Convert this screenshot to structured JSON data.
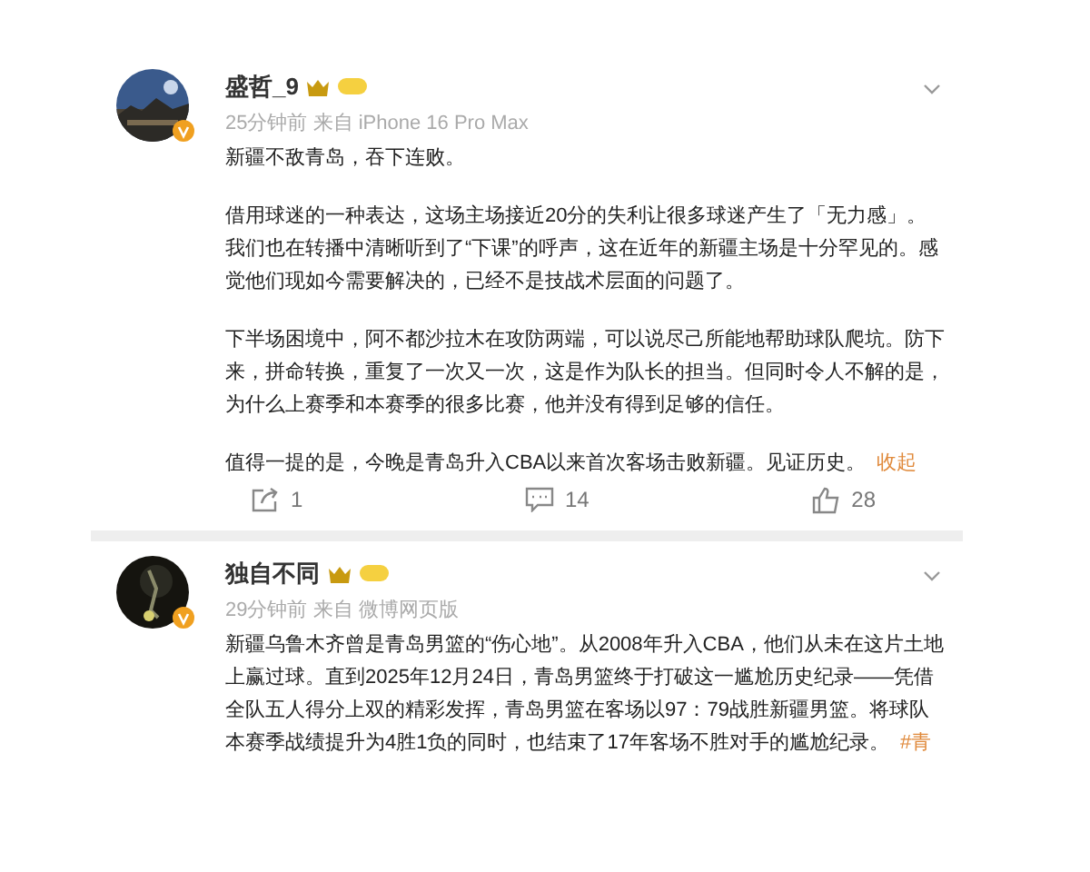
{
  "posts": [
    {
      "author": "盛哲_9",
      "meta": "25分钟前 来自 iPhone 16 Pro Max",
      "paragraphs": [
        "新疆不敌青岛，吞下连败。",
        "借用球迷的一种表达，这场主场接近20分的失利让很多球迷产生了「无力感」。我们也在转播中清晰听到了“下课”的呼声，这在近年的新疆主场是十分罕见的。感觉他们现如今需要解决的，已经不是技战术层面的问题了。",
        "下半场困境中，阿不都沙拉木在攻防两端，可以说尽己所能地帮助球队爬坑。防下来，拼命转换，重复了一次又一次，这是作为队长的担当。但同时令人不解的是，为什么上赛季和本赛季的很多比赛，他并没有得到足够的信任。",
        "值得一提的是，今晚是青岛升入CBA以来首次客场击败新疆。见证历史。"
      ],
      "link": "收起",
      "actions": [
        {
          "kind": "share",
          "count": "1"
        },
        {
          "kind": "comment",
          "count": "14"
        },
        {
          "kind": "like",
          "count": "28"
        }
      ]
    },
    {
      "author": "独自不同",
      "meta": "29分钟前 来自 微博网页版",
      "paragraphs": [
        "新疆乌鲁木齐曾是青岛男篮的“伤心地”。从2008年升入CBA，他们从未在这片土地上赢过球。直到2025年12月24日，青岛男篮终于打破这一尴尬历史纪录——凭借全队五人得分上双的精彩发挥，青岛男篮在客场以97：79战胜新疆男篮。将球队本赛季战绩提升为4胜1负的同时，也结束了17年客场不胜对手的尴尬纪录。"
      ],
      "link": "#青"
    }
  ]
}
